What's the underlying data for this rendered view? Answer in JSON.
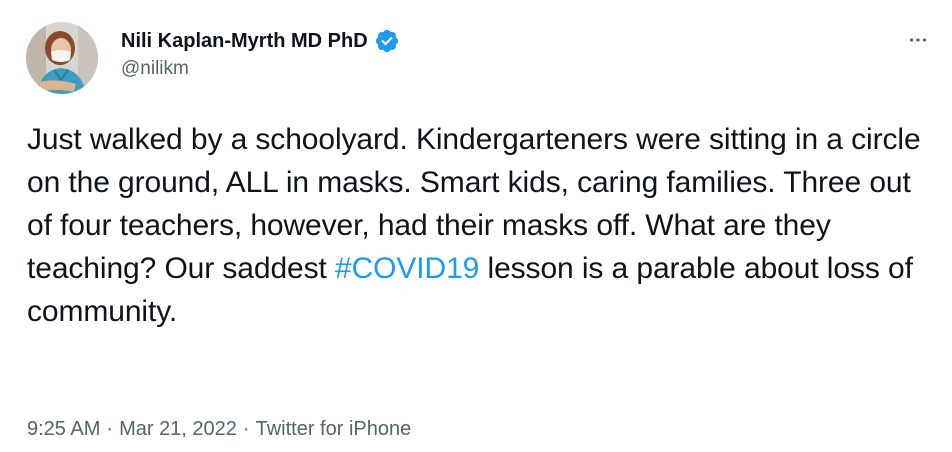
{
  "author": {
    "display_name": "Nili Kaplan-Myrth MD PhD",
    "handle": "@nilikm",
    "verified_icon": "verified-badge-icon",
    "avatar": "avatar"
  },
  "more_icon": "more-horizontal-icon",
  "tweet": {
    "text_before_hashtag": "Just walked by a schoolyard. Kindergarteners were sitting in a circle on the ground, ALL in masks. Smart kids, caring families. Three out of four teachers, however, had their masks off. What are they teaching? Our saddest ",
    "hashtag": "#COVID19",
    "text_after_hashtag": " lesson is a parable about loss of community."
  },
  "meta": {
    "time": "9:25 AM",
    "separator": "·",
    "date": "Mar 21, 2022",
    "source": "Twitter for iPhone"
  },
  "colors": {
    "accent": "#1d9bf0",
    "text": "#0f1419",
    "secondary": "#536471"
  }
}
